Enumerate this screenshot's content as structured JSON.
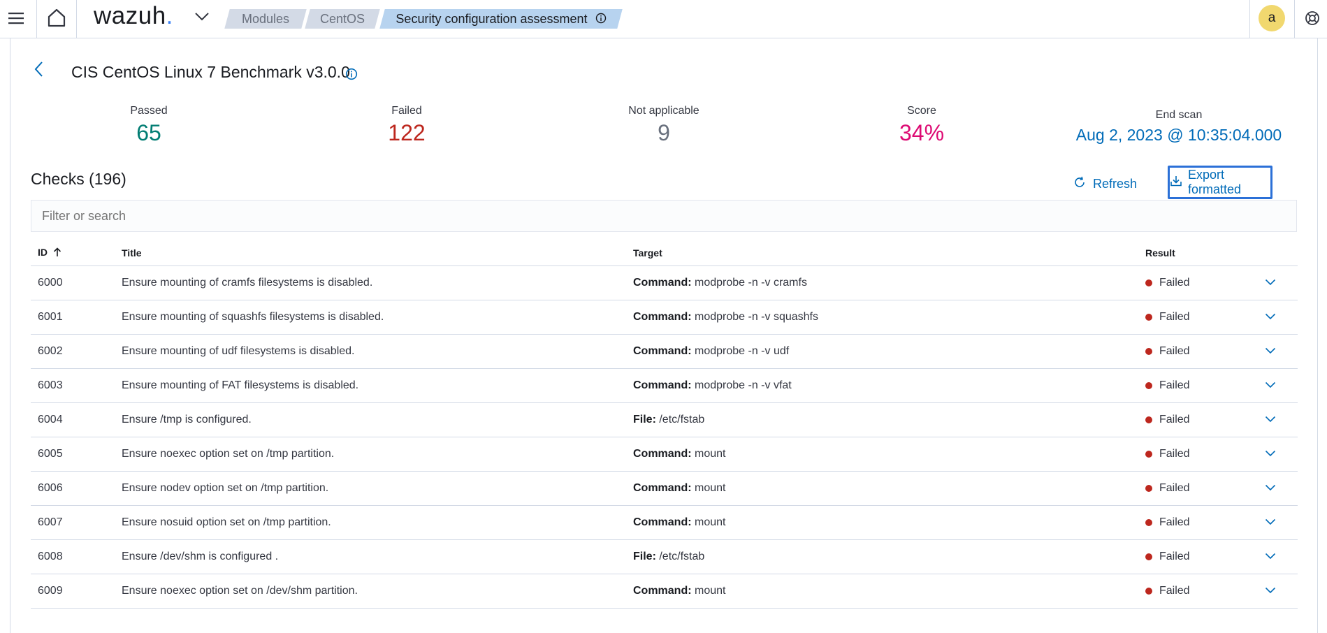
{
  "header": {
    "logo_text": "wazuh",
    "logo_dot": ".",
    "breadcrumbs": [
      {
        "label": "Modules"
      },
      {
        "label": "CentOS"
      },
      {
        "label": "Security configuration assessment"
      }
    ],
    "user_initial": "a"
  },
  "policy": {
    "title": "CIS CentOS Linux 7 Benchmark v3.0.0"
  },
  "stats": {
    "passed_label": "Passed",
    "passed_value": "65",
    "failed_label": "Failed",
    "failed_value": "122",
    "na_label": "Not applicable",
    "na_value": "9",
    "score_label": "Score",
    "score_value": "34%",
    "end_scan_label": "End scan",
    "end_scan_value": "Aug 2, 2023 @ 10:35:04.000"
  },
  "checks": {
    "title": "Checks (196)",
    "refresh_label": "Refresh",
    "export_label": "Export formatted",
    "search_placeholder": "Filter or search"
  },
  "table": {
    "columns": {
      "id": "ID",
      "title": "Title",
      "target": "Target",
      "result": "Result"
    },
    "rows": [
      {
        "id": "6000",
        "title": "Ensure mounting of cramfs filesystems is disabled.",
        "target_type": "Command:",
        "target_value": "modprobe -n -v cramfs",
        "result": "Failed"
      },
      {
        "id": "6001",
        "title": "Ensure mounting of squashfs filesystems is disabled.",
        "target_type": "Command:",
        "target_value": "modprobe -n -v squashfs",
        "result": "Failed"
      },
      {
        "id": "6002",
        "title": "Ensure mounting of udf filesystems is disabled.",
        "target_type": "Command:",
        "target_value": "modprobe -n -v udf",
        "result": "Failed"
      },
      {
        "id": "6003",
        "title": "Ensure mounting of FAT filesystems is disabled.",
        "target_type": "Command:",
        "target_value": "modprobe -n -v vfat",
        "result": "Failed"
      },
      {
        "id": "6004",
        "title": "Ensure /tmp is configured.",
        "target_type": "File:",
        "target_value": "/etc/fstab",
        "result": "Failed"
      },
      {
        "id": "6005",
        "title": "Ensure noexec option set on /tmp partition.",
        "target_type": "Command:",
        "target_value": "mount",
        "result": "Failed"
      },
      {
        "id": "6006",
        "title": "Ensure nodev option set on /tmp partition.",
        "target_type": "Command:",
        "target_value": "mount",
        "result": "Failed"
      },
      {
        "id": "6007",
        "title": "Ensure nosuid option set on /tmp partition.",
        "target_type": "Command:",
        "target_value": "mount",
        "result": "Failed"
      },
      {
        "id": "6008",
        "title": "Ensure /dev/shm is configured .",
        "target_type": "File:",
        "target_value": "/etc/fstab",
        "result": "Failed"
      },
      {
        "id": "6009",
        "title": "Ensure noexec option set on /dev/shm partition.",
        "target_type": "Command:",
        "target_value": "mount",
        "result": "Failed"
      }
    ]
  },
  "colors": {
    "passed": "#017d73",
    "failed": "#bd271e",
    "not_applicable": "#69707d",
    "score": "#dd0a73",
    "end_scan": "#006bb8",
    "link": "#006bb8"
  }
}
